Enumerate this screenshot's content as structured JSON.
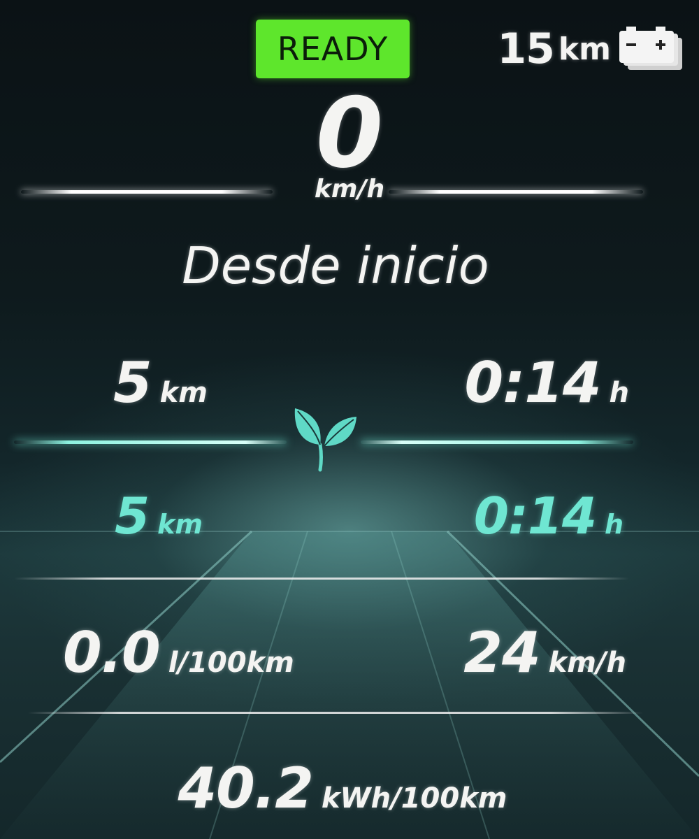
{
  "status": {
    "ready_label": "READY",
    "ready_color": "#5ee62c",
    "range_value": "15",
    "range_unit": "km",
    "battery_icon": "battery-icon"
  },
  "speed": {
    "value": "0",
    "unit": "km/h"
  },
  "section": {
    "title": "Desde inicio"
  },
  "total": {
    "distance_value": "5",
    "distance_unit": "km",
    "time_value": "0:14",
    "time_unit": "h"
  },
  "eco": {
    "icon": "leaf-icon",
    "accent_color": "#6fe6d2",
    "distance_value": "5",
    "distance_unit": "km",
    "time_value": "0:14",
    "time_unit": "h"
  },
  "consumption": {
    "fuel_value": "0.0",
    "fuel_unit": "l/100km",
    "avg_speed_value": "24",
    "avg_speed_unit": "km/h",
    "energy_value": "40.2",
    "energy_unit": "kWh/100km"
  }
}
